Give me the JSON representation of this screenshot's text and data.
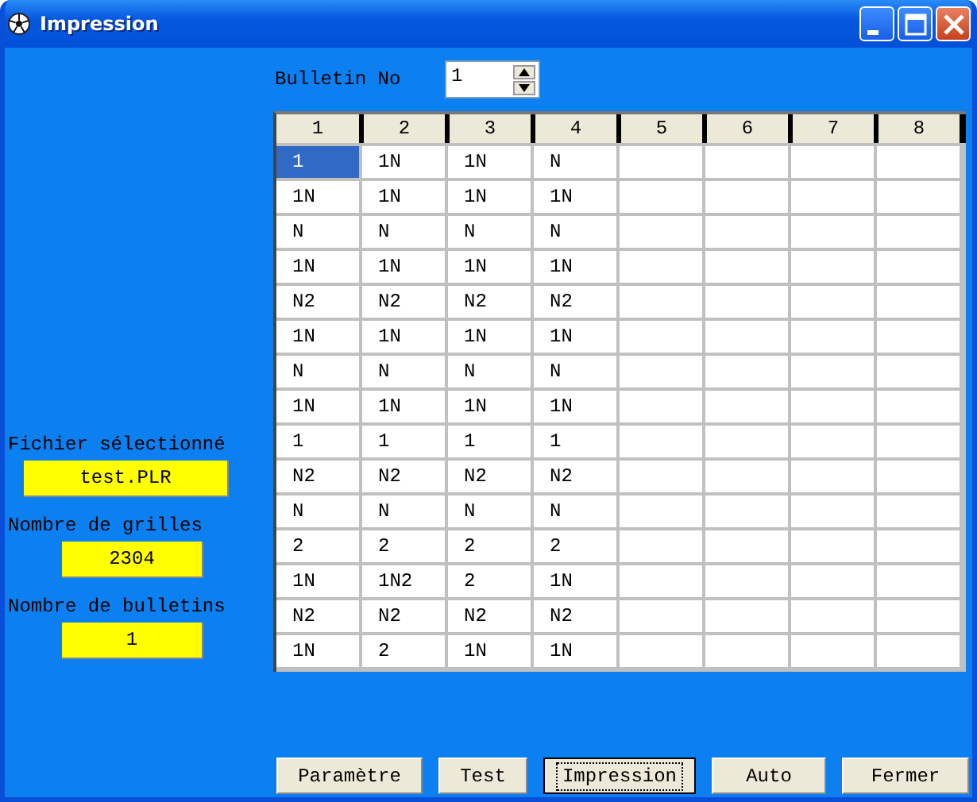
{
  "window": {
    "title": "Impression"
  },
  "bulletin": {
    "label": "Bulletin No",
    "value": "1"
  },
  "info": [
    {
      "label": "Fichier sélectionné",
      "value": "test.PLR"
    },
    {
      "label": "Nombre de grilles",
      "value": "2304"
    },
    {
      "label": "Nombre de bulletins",
      "value": "1"
    }
  ],
  "table": {
    "columns": [
      "1",
      "2",
      "3",
      "4",
      "5",
      "6",
      "7",
      "8"
    ],
    "rows": [
      [
        {
          "text": "1",
          "selected": true
        },
        {
          "text": "1N",
          "selected": false
        },
        {
          "text": "1N",
          "selected": false
        },
        {
          "text": "N",
          "selected": false
        }
      ],
      [
        {
          "text": "1N",
          "selected": false
        },
        {
          "text": "1N",
          "selected": false
        },
        {
          "text": "1N",
          "selected": false
        },
        {
          "text": "1N",
          "selected": false
        }
      ],
      [
        {
          "text": "N",
          "selected": false
        },
        {
          "text": "N",
          "selected": false
        },
        {
          "text": "N",
          "selected": false
        },
        {
          "text": "N",
          "selected": false
        }
      ],
      [
        {
          "text": "1N",
          "selected": false
        },
        {
          "text": "1N",
          "selected": false
        },
        {
          "text": "1N",
          "selected": false
        },
        {
          "text": "1N",
          "selected": false
        }
      ],
      [
        {
          "text": "N2",
          "selected": false
        },
        {
          "text": "N2",
          "selected": false
        },
        {
          "text": "N2",
          "selected": false
        },
        {
          "text": "N2",
          "selected": false
        }
      ],
      [
        {
          "text": "1N",
          "selected": false
        },
        {
          "text": "1N",
          "selected": false
        },
        {
          "text": "1N",
          "selected": false
        },
        {
          "text": "1N",
          "selected": false
        }
      ],
      [
        {
          "text": "N",
          "selected": false
        },
        {
          "text": "N",
          "selected": false
        },
        {
          "text": "N",
          "selected": false
        },
        {
          "text": "N",
          "selected": false
        }
      ],
      [
        {
          "text": "1N",
          "selected": false
        },
        {
          "text": "1N",
          "selected": false
        },
        {
          "text": "1N",
          "selected": false
        },
        {
          "text": "1N",
          "selected": false
        }
      ],
      [
        {
          "text": "1",
          "selected": false
        },
        {
          "text": "1",
          "selected": false
        },
        {
          "text": "1",
          "selected": false
        },
        {
          "text": "1",
          "selected": false
        }
      ],
      [
        {
          "text": "N2",
          "selected": false
        },
        {
          "text": "N2",
          "selected": false
        },
        {
          "text": "N2",
          "selected": false
        },
        {
          "text": "N2",
          "selected": false
        }
      ],
      [
        {
          "text": "N",
          "selected": false
        },
        {
          "text": "N",
          "selected": false
        },
        {
          "text": "N",
          "selected": false
        },
        {
          "text": "N",
          "selected": false
        }
      ],
      [
        {
          "text": "2",
          "selected": false
        },
        {
          "text": "2",
          "selected": false
        },
        {
          "text": "2",
          "selected": false
        },
        {
          "text": "2",
          "selected": false
        }
      ],
      [
        {
          "text": "1N",
          "selected": false
        },
        {
          "text": "1N2",
          "selected": false
        },
        {
          "text": "2",
          "selected": false
        },
        {
          "text": "1N",
          "selected": false
        }
      ],
      [
        {
          "text": "N2",
          "selected": false
        },
        {
          "text": "N2",
          "selected": false
        },
        {
          "text": "N2",
          "selected": false
        },
        {
          "text": "N2",
          "selected": false
        }
      ],
      [
        {
          "text": "1N",
          "selected": false
        },
        {
          "text": "2",
          "selected": false
        },
        {
          "text": "1N",
          "selected": false
        },
        {
          "text": "1N",
          "selected": false
        }
      ]
    ]
  },
  "buttons": [
    {
      "label": "Paramètre",
      "focused": false
    },
    {
      "label": "Test",
      "focused": false
    },
    {
      "label": "Impression",
      "focused": true
    },
    {
      "label": "Auto",
      "focused": false
    },
    {
      "label": "Fermer",
      "focused": false
    }
  ]
}
